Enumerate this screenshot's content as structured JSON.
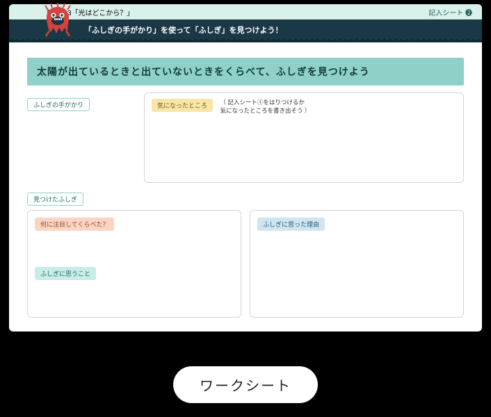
{
  "header": {
    "course_unit": "理科小3「光はどこから？」",
    "sheet_label": "記入シート",
    "sheet_number": "❷"
  },
  "subtitle": "「ふしぎの手がかり」を使って「ふしぎ」を見つけよう！",
  "prompt": "太陽が出ているときと出ていないときをくらべて、ふしぎを見つけよう",
  "sections": {
    "clues": {
      "label": "ふしぎの手がかり",
      "noticed_tag": "気になったところ",
      "hint_line1": "記入シート①をはりつけるか",
      "hint_line2": "気になったところを書き出そう"
    },
    "found": {
      "label": "見つけたふしぎ",
      "compare_tag": "何に注目してくらべた？",
      "wonder_tag": "ふしぎに思うこと",
      "reason_tag": "ふしぎに思った理由"
    }
  },
  "caption": "ワークシート"
}
